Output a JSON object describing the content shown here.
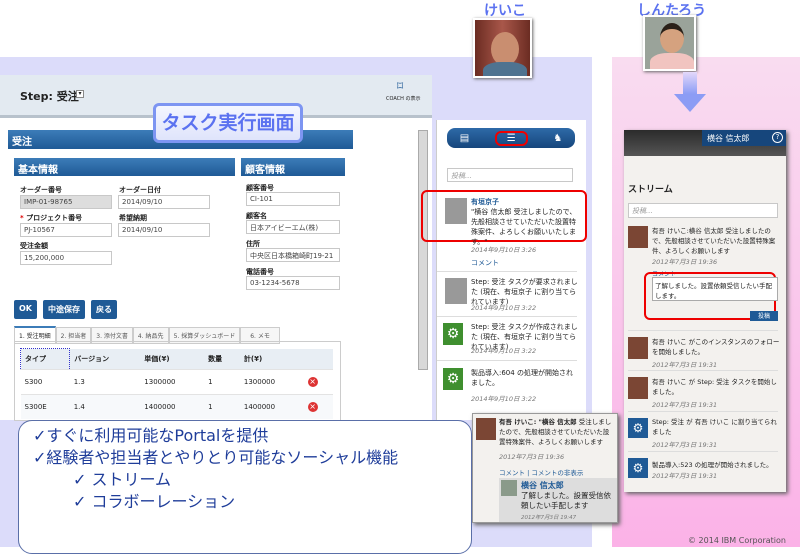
{
  "personas": [
    {
      "name": "けいこ"
    },
    {
      "name": "しんたろう"
    }
  ],
  "overlay_title": "タスク実行画面",
  "task_window": {
    "step_label": "Step: 受注",
    "coach_label": "COACH の表示",
    "section_title": "受注",
    "basic_info": {
      "title": "基本情報",
      "order_no_label": "オーダー番号",
      "order_no": "IMP-01-98765",
      "order_date_label": "オーダー日付",
      "order_date": "2014/09/10",
      "project_no_label": "プロジェクト番号",
      "project_no": "PJ-10567",
      "delivery_label": "希望納期",
      "delivery": "2014/09/10",
      "amount_label": "受注金額",
      "amount": "15,200,000"
    },
    "customer_info": {
      "title": "顧客情報",
      "cust_no_label": "顧客番号",
      "cust_no": "CI-101",
      "cust_name_label": "顧客名",
      "cust_name": "日本アイビーエム(株)",
      "address_label": "住所",
      "address": "中央区日本橋箱崎町19-21",
      "phone_label": "電話番号",
      "phone": "03-1234-5678"
    },
    "buttons": {
      "ok": "OK",
      "save": "中途保存",
      "back": "戻る"
    },
    "tabs": [
      "1. 受注明細",
      "2. 担当者",
      "3. 添付文書",
      "4. 納品先",
      "5. 採算ダッシュボード",
      "6. メモ"
    ],
    "table": {
      "headers": [
        "タイプ",
        "バージョン",
        "単価(¥)",
        "数量",
        "計(¥)"
      ],
      "rows": [
        [
          "S300",
          "1.3",
          "1300000",
          "1",
          "1300000"
        ],
        [
          "S300E",
          "1.4",
          "1400000",
          "1",
          "1400000"
        ]
      ]
    }
  },
  "stream_panel": {
    "post_placeholder": "投稿...",
    "items": [
      {
        "author": "有垣京子",
        "text": "\"横谷 信太郎 受注しましたので、先般相談させていただいた設置特殊案件、よろしくお願いいたします。\"",
        "time": "2014年9月10日 3:26",
        "comment": "コメント"
      },
      {
        "text": "Step: 受注 タスクが要求されました (現在、有垣京子 に割り当てられています)",
        "time": "2014年9月10日 3:22"
      },
      {
        "text": "Step: 受注 タスクが作成されました (現在、有垣京子 に割り当てられています)",
        "time": "2014年9月10日 3:22"
      },
      {
        "text": "製品導入:604 の処理が開始されました。",
        "time": "2014年9月10日 3:22"
      }
    ]
  },
  "popup": {
    "author": "有吾 けいこ:",
    "mention": "\"横谷 信太郎",
    "text": "受注しましたので、先般相談させていただいた設置特殊案件、よろしくお願いします",
    "time": "2012年7月3日 19:36",
    "links": "コメント | コメントの非表示",
    "reply_author": "横谷 信太郎",
    "reply_text": "了解しました。設置受信依頼したい手配します",
    "reply_time": "2012年7月3日 19:47"
  },
  "phone": {
    "user": "横谷 信太郎",
    "help_icon": "?",
    "title": "ストリーム",
    "post_placeholder": "投稿...",
    "first": {
      "text": "有吾 けいこ:横谷 信太郎 受注しましたので、先般相談させていただいた設置特殊案件、よろしくお願いします",
      "time": "2012年7月3日 19:36"
    },
    "comment_label": "コメント",
    "comment_value": "了解しました。設置依頼受信したい手配します。",
    "submit": "投稿",
    "items": [
      {
        "text": "有吾 けいこ がこのインスタンスのフォローを開始しました。",
        "time": "2012年7月3日 19:31"
      },
      {
        "text": "有吾 けいこ が Step: 受注 タスクを開始しました。",
        "time": "2012年7月3日 19:31"
      },
      {
        "text": "Step: 受注 が 有吾 けいこ に割り当てられました",
        "time": "2012年7月3日 19:31"
      },
      {
        "text": "製品導入:523 の処理が開始されました。",
        "time": "2012年7月3日 19:31"
      }
    ]
  },
  "callout": {
    "lines": [
      "✓すぐに利用可能なPortalを提供",
      "✓経験者や担当者とやりとり可能なソーシャル機能"
    ],
    "sub": [
      "✓ ストリーム",
      "✓ コラボーレーション"
    ]
  },
  "copyright": "© 2014 IBM Corporation"
}
